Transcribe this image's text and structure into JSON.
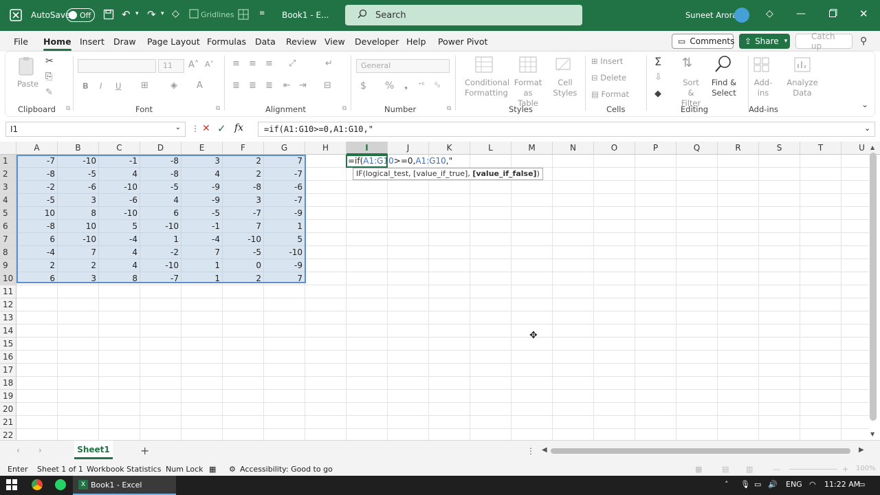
{
  "titlebar": {
    "autosave_label": "AutoSave",
    "autosave_state": "Off",
    "gridlines_label": "Gridlines",
    "doc_title": "Book1 - E...",
    "search_placeholder": "Search",
    "user_name": "Suneet Arora"
  },
  "menu": {
    "items": [
      "File",
      "Home",
      "Insert",
      "Draw",
      "Page Layout",
      "Formulas",
      "Data",
      "Review",
      "View",
      "Developer",
      "Help",
      "Power Pivot"
    ],
    "comments_label": "Comments",
    "share_label": "Share",
    "catchup_label": "Catch up"
  },
  "ribbon": {
    "clipboard": {
      "paste": "Paste",
      "label": "Clipboard"
    },
    "font": {
      "label": "Font",
      "size": "11",
      "bold": "B",
      "italic": "I",
      "underline": "U"
    },
    "alignment": {
      "label": "Alignment"
    },
    "number": {
      "label": "Number",
      "format": "General",
      "currency": "$",
      "percent": "%"
    },
    "styles": {
      "label": "Styles",
      "conditional1": "Conditional",
      "conditional2": "Formatting",
      "format_table1": "Format as",
      "format_table2": "Table",
      "cell_styles1": "Cell",
      "cell_styles2": "Styles"
    },
    "cells": {
      "label": "Cells",
      "insert": "Insert",
      "delete": "Delete",
      "format": "Format"
    },
    "editing": {
      "label": "Editing",
      "sort1": "Sort &",
      "sort2": "Filter",
      "find1": "Find &",
      "find2": "Select"
    },
    "addins": {
      "label": "Add-ins",
      "addins_btn1": "Add-",
      "addins_btn2": "ins",
      "analyze1": "Analyze",
      "analyze2": "Data"
    }
  },
  "formula_bar": {
    "name_box": "I1",
    "formula": "=if(A1:G10>=0,A1:G10,\""
  },
  "grid": {
    "columns": [
      "A",
      "B",
      "C",
      "D",
      "E",
      "F",
      "G",
      "H",
      "I",
      "J",
      "K",
      "L",
      "M",
      "N",
      "O",
      "P",
      "Q",
      "R",
      "S",
      "T",
      "U"
    ],
    "rows": [
      "1",
      "2",
      "3",
      "4",
      "5",
      "6",
      "7",
      "8",
      "9",
      "10",
      "11",
      "12",
      "13",
      "14",
      "15",
      "16",
      "17",
      "18",
      "19",
      "20",
      "21",
      "22"
    ],
    "values": [
      [
        "-7",
        "-10",
        "-1",
        "-8",
        "3",
        "2",
        "7"
      ],
      [
        "-8",
        "-5",
        "4",
        "-8",
        "4",
        "2",
        "-7"
      ],
      [
        "-2",
        "-6",
        "-10",
        "-5",
        "-9",
        "-8",
        "-6"
      ],
      [
        "-5",
        "3",
        "-6",
        "4",
        "-9",
        "3",
        "-7"
      ],
      [
        "10",
        "8",
        "-10",
        "6",
        "-5",
        "-7",
        "-9"
      ],
      [
        "-8",
        "10",
        "5",
        "-10",
        "-1",
        "7",
        "1"
      ],
      [
        "6",
        "-10",
        "-4",
        "1",
        "-4",
        "-10",
        "5"
      ],
      [
        "-4",
        "7",
        "4",
        "-2",
        "7",
        "-5",
        "-10"
      ],
      [
        "2",
        "2",
        "4",
        "-10",
        "1",
        "0",
        "-9"
      ],
      [
        "6",
        "3",
        "8",
        "-7",
        "1",
        "2",
        "7"
      ]
    ],
    "cell_edit": {
      "prefix": "=if(",
      "range1": "A1:G10",
      "mid": ">=0,",
      "range2": "A1:G10",
      "suffix": ",\""
    },
    "tooltip": {
      "func": "IF(",
      "arg1": "logical_test",
      "arg2": "[value_if_true]",
      "arg3": "[value_if_false]",
      "close": ")"
    }
  },
  "sheets": {
    "active": "Sheet1"
  },
  "status": {
    "mode": "Enter",
    "sheet_info": "Sheet 1 of 1",
    "workbook_stats": "Workbook Statistics",
    "num_lock": "Num Lock",
    "accessibility": "Accessibility: Good to go",
    "zoom": "100%"
  },
  "taskbar": {
    "excel_task": "Book1 - Excel",
    "lang": "ENG",
    "time": "11:22 AM"
  },
  "colors": {
    "excel_green": "#217346",
    "selection_blue": "#5b8fce"
  }
}
